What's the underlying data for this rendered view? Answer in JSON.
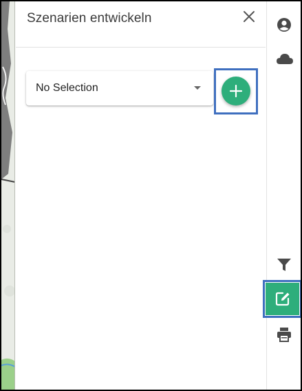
{
  "panel": {
    "title": "Szenarien entwickeln",
    "close_icon": "close-icon"
  },
  "scenario_select": {
    "selected": "No Selection",
    "arrow_icon": "dropdown-arrow-icon"
  },
  "add_button": {
    "icon": "plus-icon",
    "color": "#2eae7b"
  },
  "toolbar": {
    "items": [
      {
        "name": "account-icon"
      },
      {
        "name": "cloud-icon"
      },
      {
        "name": "filter-icon"
      },
      {
        "name": "edit-icon",
        "active": true
      },
      {
        "name": "print-icon"
      }
    ],
    "active_color": "#2eae7b",
    "icon_color": "#4a4a4a"
  },
  "highlight_color": "#3f6fbf"
}
